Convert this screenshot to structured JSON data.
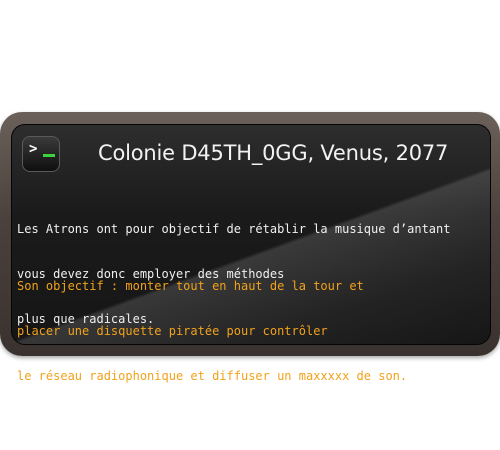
{
  "header": {
    "icon": "terminal-icon",
    "title": "Colonie D45TH_0GG, Venus, 2077"
  },
  "intro": {
    "lines": [
      "Les Atrons ont pour objectif de rétablir la musique d’antant",
      "vous devez donc employer des méthodes",
      "plus que radicales."
    ]
  },
  "objective": {
    "lines": [
      "Son objectif : monter tout en haut de la tour et",
      "placer une disquette piratée pour contrôler",
      "le réseau radiophonique et diffuser un maxxxxx de son."
    ]
  },
  "colors": {
    "intro_text": "#f0f0f0",
    "objective_text": "#f0a21c",
    "cursor": "#3fd23f",
    "screen": "#161616",
    "frame": "#4a413c"
  }
}
